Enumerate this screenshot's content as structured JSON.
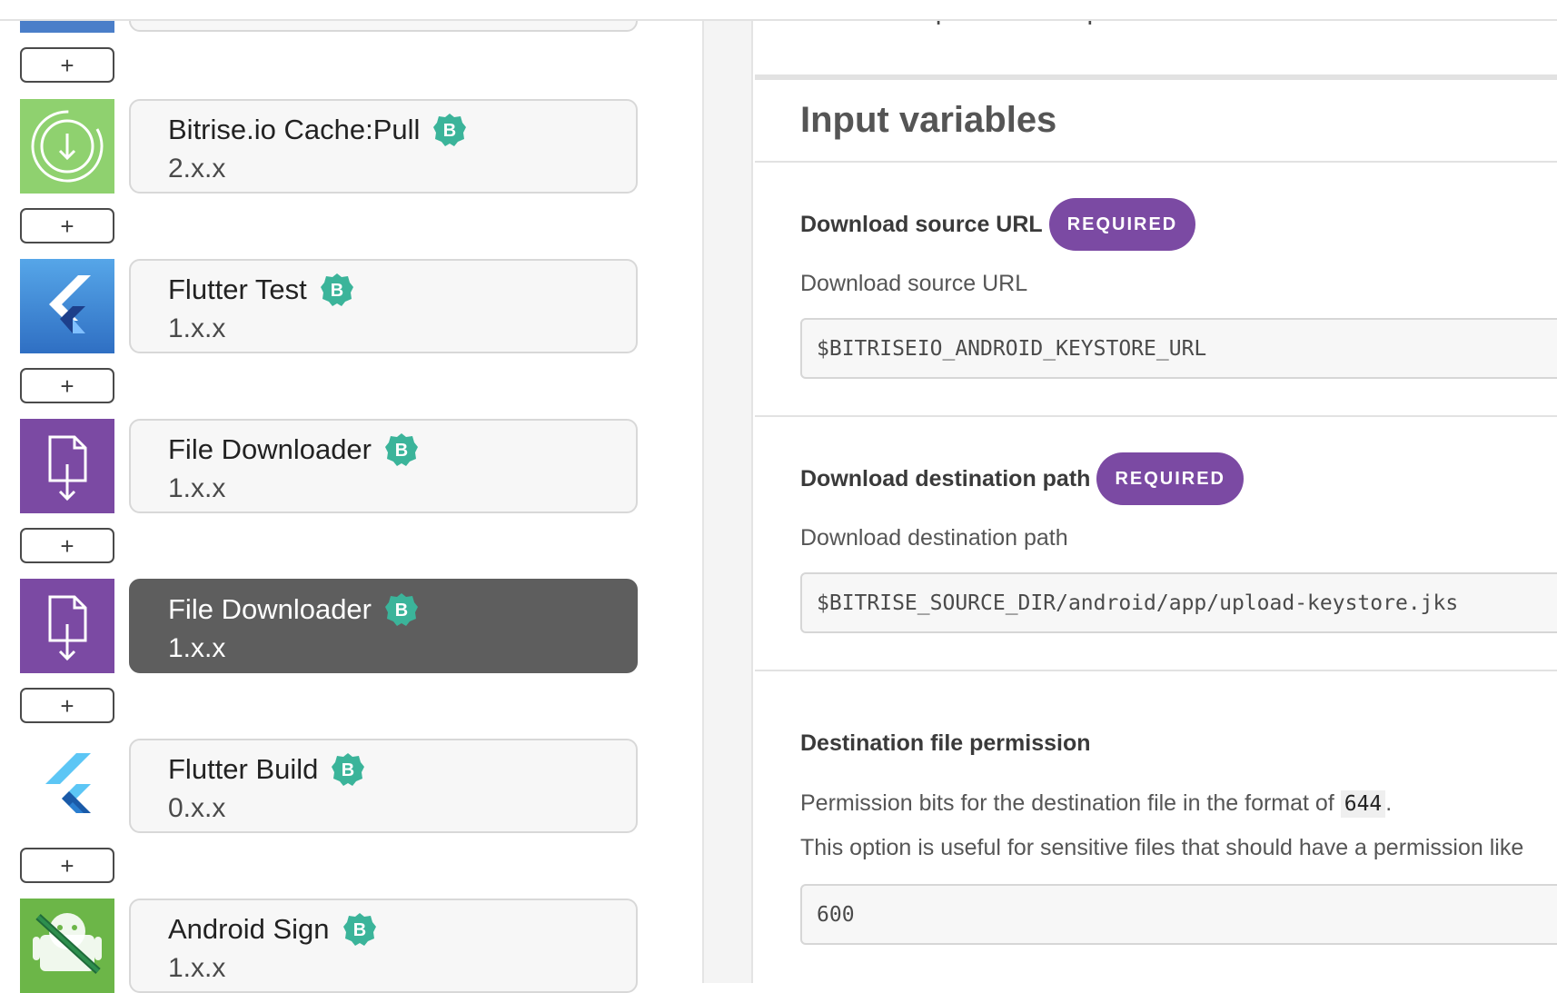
{
  "workflow": {
    "add_label": "+",
    "steps": [
      {
        "name": "Bitrise.io Cache:Pull",
        "version": "2.x.x",
        "icon": "cache-pull-icon",
        "badge": "B",
        "selected": false
      },
      {
        "name": "Flutter Test",
        "version": "1.x.x",
        "icon": "flutter-test-icon",
        "badge": "B",
        "selected": false
      },
      {
        "name": "File Downloader",
        "version": "1.x.x",
        "icon": "file-download-icon",
        "badge": "B",
        "selected": false
      },
      {
        "name": "File Downloader",
        "version": "1.x.x",
        "icon": "file-download-icon",
        "badge": "B",
        "selected": true
      },
      {
        "name": "Flutter Build",
        "version": "0.x.x",
        "icon": "flutter-build-icon",
        "badge": "B",
        "selected": false
      },
      {
        "name": "Android Sign",
        "version": "1.x.x",
        "icon": "android-sign-icon",
        "badge": "B",
        "selected": false
      }
    ]
  },
  "detail": {
    "run_if_text": "Run if previous Step failed",
    "section_title": "Input variables",
    "required_label": "REQUIRED",
    "inputs": [
      {
        "label": "Download source URL",
        "required": true,
        "description": "Download source URL",
        "value": "$BITRISEIO_ANDROID_KEYSTORE_URL"
      },
      {
        "label": "Download destination path",
        "required": true,
        "description": "Download destination path",
        "value": "$BITRISE_SOURCE_DIR/android/app/upload-keystore.jks"
      },
      {
        "label": "Destination file permission",
        "required": false,
        "description_prefix": "Permission bits for the destination file in the format of ",
        "description_code": "644",
        "description_suffix": ".",
        "description_line2": "This option is useful for sensitive files that should have a permission like",
        "value": "600"
      }
    ]
  },
  "colors": {
    "accent_purple": "#7b4aa3",
    "badge_teal": "#3bb49a",
    "cache_green": "#8fd16f",
    "selected_card": "#5e5e5e"
  }
}
